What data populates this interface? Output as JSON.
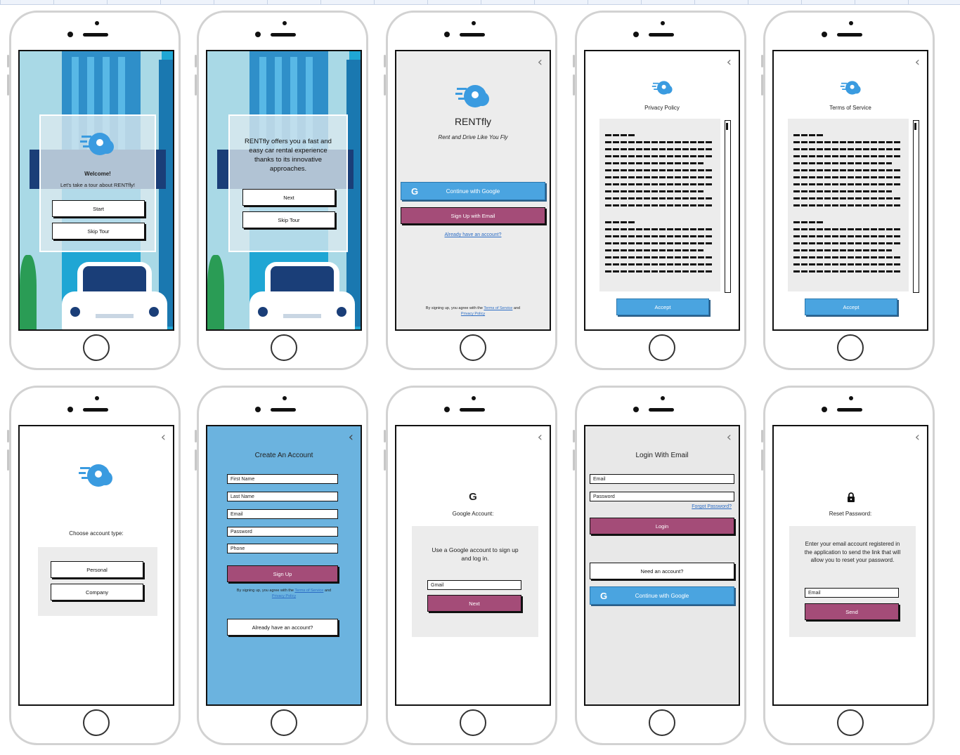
{
  "app": {
    "brand": "RENTfly",
    "tagline": "Rent and Drive Like You Fly"
  },
  "colors": {
    "accent_blue": "#4aa4e0",
    "accent_pink": "#a44c78",
    "screen_blue": "#6bb3df",
    "panel_gray": "#ececec"
  },
  "icons": {
    "back": "chevron-left-icon",
    "logo": "rentfly-logo-icon",
    "google": "google-g-icon",
    "lock": "lock-icon"
  },
  "screens": {
    "welcome": {
      "heading": "Welcome!",
      "subtitle": "Let's take a tour about RENTfly!",
      "start": "Start",
      "skip": "Skip Tour"
    },
    "tour": {
      "text": "RENTfly offers you a fast and easy car rental experience thanks to its innovative approaches.",
      "next": "Next",
      "skip": "Skip Tour"
    },
    "signup_home": {
      "google": "Continue with Google",
      "email": "Sign Up with Email",
      "have_account": "Already have an account?",
      "legal_prefix": "By signing up, you agree with the",
      "terms": "Terms of Service",
      "and": "and",
      "privacy": "Privacy Policy"
    },
    "privacy": {
      "title": "Privacy Policy",
      "accept": "Accept"
    },
    "terms": {
      "title": "Terms of Service",
      "accept": "Accept"
    },
    "account_type": {
      "title": "Choose account type:",
      "personal": "Personal",
      "company": "Company"
    },
    "create_account": {
      "title": "Create An Account",
      "first_name": "First Name",
      "last_name": "Last Name",
      "email": "Email",
      "password": "Password",
      "phone": "Phone",
      "signup": "Sign Up",
      "legal_prefix": "By signing up, you agree with the",
      "terms": "Terms of Service",
      "and": "and",
      "privacy": "Privacy Policy",
      "have_account": "Already have an account?"
    },
    "google_account": {
      "title": "Google Account:",
      "text": "Use a Google account to sign up and log in.",
      "gmail": "Gmail",
      "next": "Next"
    },
    "login": {
      "title": "Login With Email",
      "email": "Email",
      "password": "Password",
      "forgot": "Forgot Password?",
      "login": "Login",
      "need_account": "Need an account?",
      "google": "Continue with Google"
    },
    "reset": {
      "title": "Reset Password:",
      "text": "Enter your email account registered in the application to send the link that will allow you to reset your password.",
      "email": "Email",
      "send": "Send"
    }
  }
}
